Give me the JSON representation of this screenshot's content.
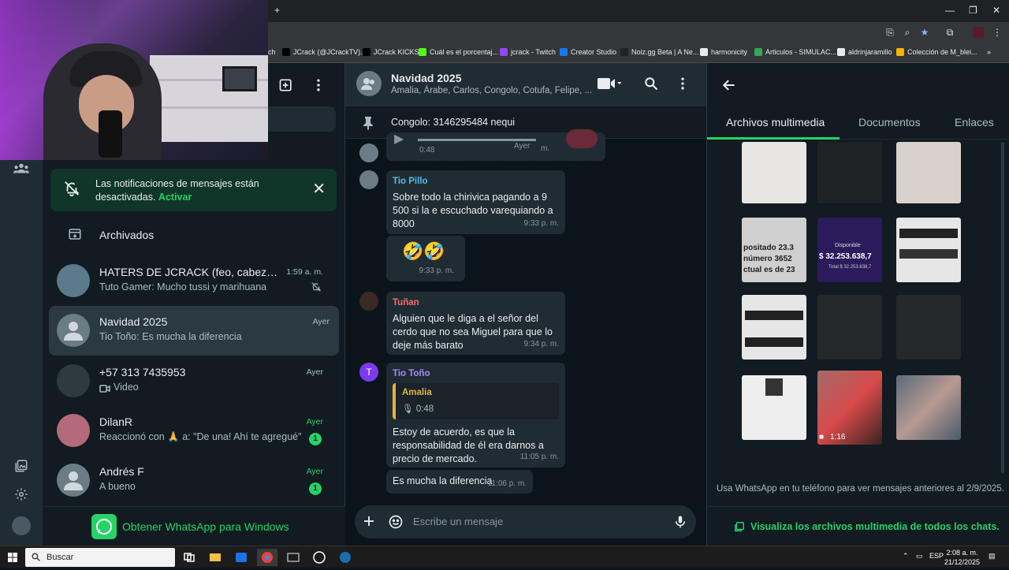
{
  "browser": {
    "bookmarks": [
      {
        "label": "ch",
        "color": "#35363a"
      },
      {
        "label": "JCrack (@JCrackTV)...",
        "color": "#000000"
      },
      {
        "label": "JCrack KICKS",
        "color": "#000000"
      },
      {
        "label": "Cuál es el porcentaj...",
        "color": "#53fc18"
      },
      {
        "label": "jcrack - Twitch",
        "color": "#9146ff"
      },
      {
        "label": "Creator Studio",
        "color": "#1877f2"
      },
      {
        "label": "Noiz.gg Beta | A Ne...",
        "color": "#222222"
      },
      {
        "label": "harmonicity",
        "color": "#e8eaed"
      },
      {
        "label": "Articulos - SIMULAC...",
        "color": "#34a853"
      },
      {
        "label": "aldrinjaramillo",
        "color": "#e8eaed"
      },
      {
        "label": "Colección de M_blei...",
        "color": "#f4b400"
      }
    ],
    "more_bookmarks": "»",
    "new_tab": "+",
    "window_controls": {
      "minimize": "—",
      "maximize": "❐",
      "close": "✕"
    }
  },
  "sidebar": {
    "notice": {
      "text": "Las notificaciones de mensajes están desactivadas.",
      "link": "Activar"
    },
    "archived_label": "Archivados",
    "chats": [
      {
        "name": "HATERS DE JCRACK (feo, cabeza de ...",
        "preview": "Tuto Gamer: Mucho tussi y marihuana",
        "time": "1:59 a. m.",
        "muted": true,
        "unread": "",
        "active": false
      },
      {
        "name": "Navidad 2025",
        "preview": "Tio Toño: Es mucha la diferencia",
        "time": "Ayer",
        "muted": false,
        "unread": "",
        "active": true
      },
      {
        "name": "+57 313 7435953",
        "preview": "Video",
        "time": "Ayer",
        "muted": false,
        "unread": "",
        "active": false
      },
      {
        "name": "DilanR",
        "preview": "Reaccionó con 🙏 a: \"De una! Ahí te agregué\"",
        "time": "Ayer",
        "muted": false,
        "unread": "1",
        "active": false
      },
      {
        "name": "Andrés F",
        "preview": "A bueno",
        "time": "Ayer",
        "muted": false,
        "unread": "1",
        "active": false
      }
    ],
    "get_whatsapp": "Obtener WhatsApp para Windows"
  },
  "conversation": {
    "title": "Navidad 2025",
    "members": "Amalia, Árabe, Carlos, Congolo, Cotufa, Felipe, ...",
    "pinned": "Congolo: 3146295484 nequi",
    "voice_top": {
      "duration": "0:48",
      "time": "Ayer",
      "suffix": "m."
    },
    "messages": [
      {
        "sender": "Tio Pillo",
        "sender_color": "#53bdeb",
        "text": "Sobre todo la chirivica pagando a 9 500 si la e escuchado varequiando a 8000",
        "time": "9:33 p. m."
      },
      {
        "sender": "",
        "text": "🤣🤣",
        "time": "9:33 p. m."
      },
      {
        "sender": "Tuñan",
        "sender_color": "#fc6b6b",
        "text": "Alguien que le diga a el señor del cerdo que no sea Miguel para que lo deje más barato",
        "time": "9:34 p. m."
      },
      {
        "sender": "Tio Toño",
        "sender_color": "#a78bfa",
        "avatar_letter": "T",
        "quote_name": "Amalia",
        "quote_duration": "0:48",
        "text": "Estoy de acuerdo, es que la responsabilidad de él era darnos a precio de mercado.",
        "time": "11:05 p. m."
      },
      {
        "sender": "",
        "text": "Es mucha la diferencia",
        "time": "11:06 p. m."
      }
    ],
    "composer_placeholder": "Escribe un mensaje"
  },
  "media_panel": {
    "tabs": [
      "Archivos multimedia",
      "Documentos",
      "Enlaces"
    ],
    "video_duration": "1:16",
    "footer_note": "Usa WhatsApp en tu teléfono para ver mensajes anteriores al 2/9/2025.",
    "view_all": "Visualiza los archivos multimedia de todos los chats.",
    "thumb_texts": {
      "t4": "positado 23.3 número 3652 ctual es de 23",
      "t5_label": "Disponible",
      "t5_amount": "$ 32.253.638,7",
      "t5_total": "Total $ 32.253.638,7"
    }
  },
  "taskbar": {
    "search_label": "Buscar",
    "language": "ESP",
    "time": "2:08 a. m.",
    "date": "21/12/2025"
  }
}
